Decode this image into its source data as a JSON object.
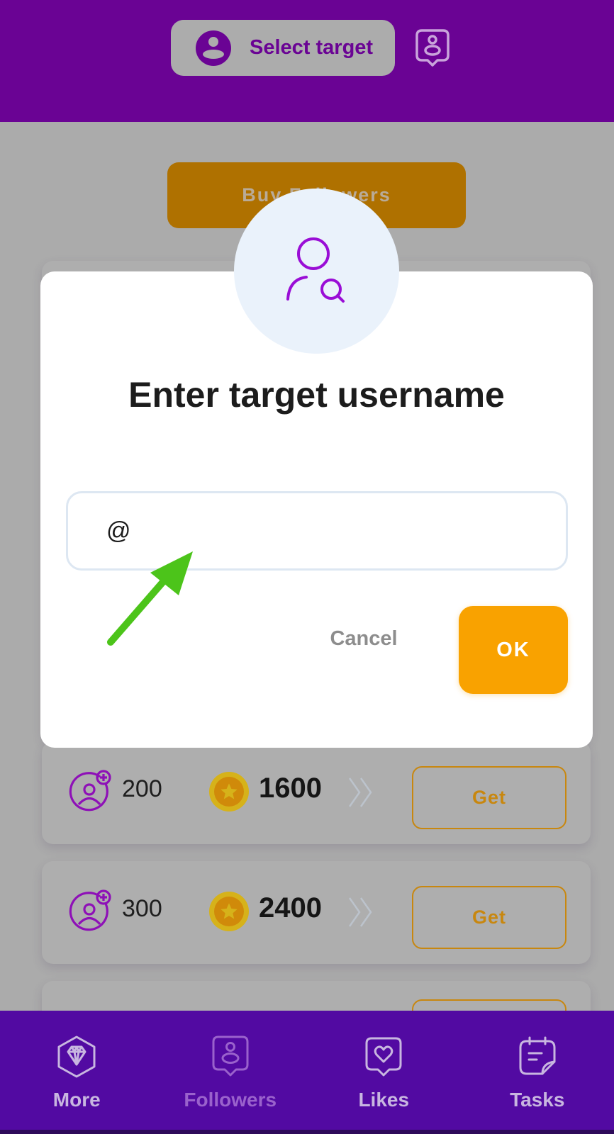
{
  "header": {
    "select_target_label": "Select target",
    "icons": [
      "user-circle-icon",
      "profile-badge-icon"
    ]
  },
  "main": {
    "buy_button_label": "Buy Followers",
    "offers": [
      {
        "followers": "200",
        "price": "1600",
        "action": "Get"
      },
      {
        "followers": "300",
        "price": "2400",
        "action": "Get"
      }
    ]
  },
  "modal": {
    "title": "Enter target username",
    "icon": "user-search-icon",
    "input_value": "@",
    "cancel_label": "Cancel",
    "ok_label": "OK"
  },
  "bottom_nav": {
    "items": [
      {
        "label": "More",
        "icon": "diamond-icon",
        "active": false
      },
      {
        "label": "Followers",
        "icon": "profile-badge-icon",
        "active": true
      },
      {
        "label": "Likes",
        "icon": "heart-badge-icon",
        "active": false
      },
      {
        "label": "Tasks",
        "icon": "notepad-icon",
        "active": false
      }
    ]
  },
  "colors": {
    "primary_purple": "#6a0394",
    "nav_purple": "#520aa2",
    "accent_orange": "#f9a200",
    "annotation_green": "#4cc41a"
  }
}
